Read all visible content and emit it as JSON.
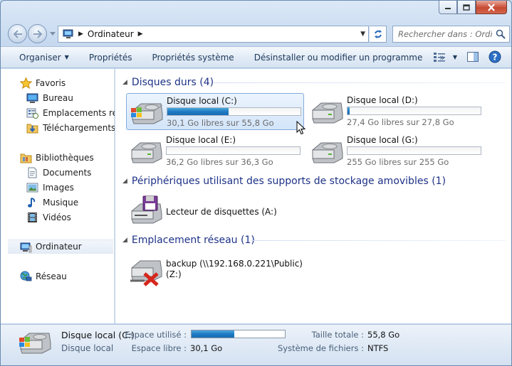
{
  "window": {
    "caption_buttons": [
      "minimize",
      "maximize",
      "close"
    ]
  },
  "nav": {
    "address_crumb": "Ordinateur",
    "search_placeholder": "Rechercher dans : Ordin..."
  },
  "toolbar": {
    "organize": "Organiser",
    "properties": "Propriétés",
    "system_properties": "Propriétés système",
    "uninstall": "Désinstaller ou modifier un programme",
    "more": "»"
  },
  "sidebar": {
    "favorites": {
      "label": "Favoris",
      "items": [
        {
          "label": "Bureau",
          "icon": "desktop-icon"
        },
        {
          "label": "Emplacements récents",
          "icon": "recent-places-icon"
        },
        {
          "label": "Téléchargements",
          "icon": "downloads-icon"
        }
      ]
    },
    "libraries": {
      "label": "Bibliothèques",
      "items": [
        {
          "label": "Documents",
          "icon": "documents-icon"
        },
        {
          "label": "Images",
          "icon": "pictures-icon"
        },
        {
          "label": "Musique",
          "icon": "music-icon"
        },
        {
          "label": "Vidéos",
          "icon": "videos-icon"
        }
      ]
    },
    "computer": {
      "label": "Ordinateur"
    },
    "network": {
      "label": "Réseau"
    }
  },
  "groups": {
    "hard_drives": {
      "title": "Disques durs (4)",
      "drives": [
        {
          "name": "Disque local (C:)",
          "free": "30,1 Go libres sur 55,8 Go",
          "used_fraction": 0.46,
          "selected": true
        },
        {
          "name": "Disque local (D:)",
          "free": "27,4 Go libres sur 27,8 Go",
          "used_fraction": 0.015
        },
        {
          "name": "Disque local (E:)",
          "free": "36,2 Go libres sur 36,3 Go",
          "used_fraction": 0.0
        },
        {
          "name": "Disque local (G:)",
          "free": "255 Go libres sur 255 Go",
          "used_fraction": 0.0
        }
      ]
    },
    "removable": {
      "title": "Périphériques utilisant des supports de stockage amovibles (1)",
      "items": [
        {
          "name": "Lecteur de disquettes (A:)"
        }
      ]
    },
    "network": {
      "title": "Emplacement réseau (1)",
      "items": [
        {
          "name": "backup (\\\\192.168.0.221\\Public)",
          "letter": "(Z:)"
        }
      ]
    }
  },
  "details": {
    "name": "Disque local (C:)",
    "type": "Disque local",
    "used_space_label": "Espace utilisé :",
    "used_fraction": 0.46,
    "free_space_label": "Espace libre :",
    "free_space_value": "30,1 Go",
    "total_size_label": "Taille totale :",
    "total_size_value": "55,8 Go",
    "filesystem_label": "Système de fichiers :",
    "filesystem_value": "NTFS"
  },
  "colors": {
    "group_title": "#1e3287",
    "bar_fill": "#1f7ac3",
    "toolbar_text": "#1e395b"
  }
}
